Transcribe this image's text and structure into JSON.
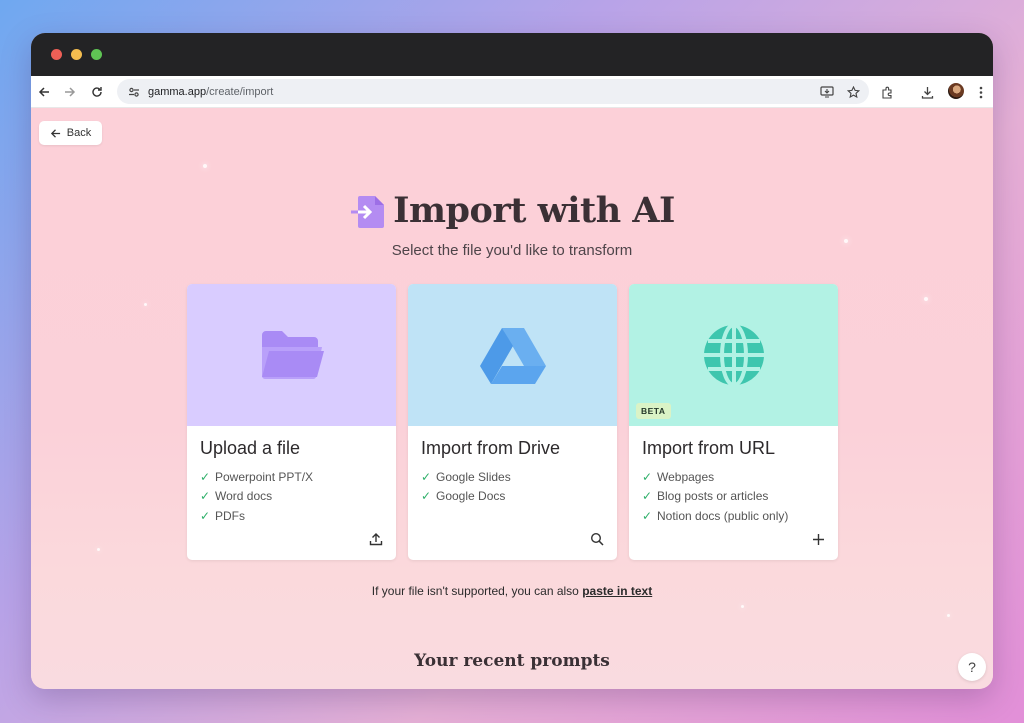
{
  "browser": {
    "url_host": "gamma.app",
    "url_path": "/create/import"
  },
  "page": {
    "back_label": "Back",
    "title": "Import with AI",
    "subtitle": "Select the file you'd like to transform",
    "cards": [
      {
        "title": "Upload a file",
        "features": [
          "Powerpoint PPT/X",
          "Word docs",
          "PDFs"
        ],
        "bg_color": "#d9ccff",
        "icon": "folder-icon"
      },
      {
        "title": "Import from Drive",
        "features": [
          "Google Slides",
          "Google Docs"
        ],
        "bg_color": "#bfe3f6",
        "icon": "google-drive-icon"
      },
      {
        "title": "Import from URL",
        "features": [
          "Webpages",
          "Blog posts or articles",
          "Notion docs (public only)"
        ],
        "bg_color": "#b2f2e4",
        "icon": "globe-icon",
        "badge": "BETA"
      }
    ],
    "note_prefix": "If your file isn't supported, you can also ",
    "note_link": "paste in text",
    "recent_heading": "Your recent prompts",
    "help_label": "?"
  },
  "colors": {
    "accent_purple": "#b48cf2",
    "check_green": "#2fb06a",
    "page_pink": "#fbd1d9"
  }
}
